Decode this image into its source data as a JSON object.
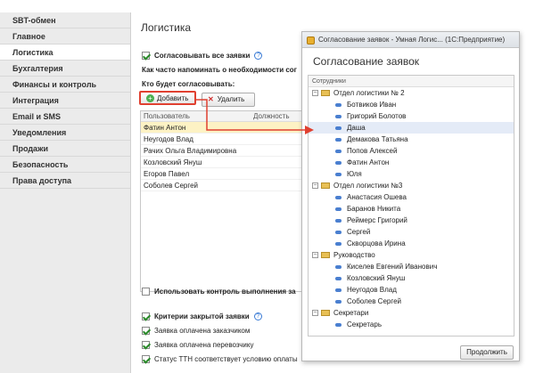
{
  "sidebar": {
    "items": [
      {
        "label": "SBT-обмен"
      },
      {
        "label": "Главное"
      },
      {
        "label": "Логистика"
      },
      {
        "label": "Бухгалтерия"
      },
      {
        "label": "Финансы и контроль"
      },
      {
        "label": "Интеграция"
      },
      {
        "label": "Email и SMS"
      },
      {
        "label": "Уведомления"
      },
      {
        "label": "Продажи"
      },
      {
        "label": "Безопасность"
      },
      {
        "label": "Права доступа"
      }
    ]
  },
  "main": {
    "title": "Логистика",
    "approve_all": "Согласовывать все заявки",
    "remind_text": "Как часто напоминать о необходимости сог",
    "who_text": "Кто будет согласовывать:",
    "add_label": "Добавить",
    "delete_label": "Удалить",
    "grid": {
      "col_user": "Пользователь",
      "col_position": "Должность",
      "rows": [
        "Фатин Антон",
        "Неугодов Влад",
        "Рачих Ольга Владимировна",
        "Козловский Януш",
        "Егоров Павел",
        "Соболев Сергей"
      ]
    },
    "control_text": "Использовать контроль выполнения за",
    "criteria_text": "Критерии закрытой заявки",
    "crit1": "Заявка оплачена заказчиком",
    "crit2": "Заявка оплачена перевозчику",
    "crit3": "Статус ТТН соответствует условию оплаты"
  },
  "dialog": {
    "window_title": "Согласование заявок - Умная Логис... (1С:Предприятие)",
    "heading": "Согласование заявок",
    "tree_header": "Сотрудники",
    "groups": [
      {
        "name": "Отдел логистики № 2",
        "members": [
          "Ботвиков Иван",
          "Григорий Болотов",
          "Даша",
          "Демакова Татьяна",
          "Попов Алексей",
          "Фатин Антон",
          "Юля"
        ]
      },
      {
        "name": "Отдел логистики №3",
        "members": [
          "Анастасия Ошева",
          "Баранов Никита",
          "Реймерс Григорий",
          "Сергей",
          "Скворцова Ирина"
        ]
      },
      {
        "name": "Руководство",
        "members": [
          "Киселев Евгений Иванович",
          "Козловский Януш",
          "Неугодов Влад",
          "Соболев Сергей"
        ]
      },
      {
        "name": "Секретари",
        "members": [
          "Секретарь"
        ]
      }
    ],
    "continue_label": "Продолжить"
  },
  "colors": {
    "highlight": "#e04030",
    "selected_row": "#fdf2c4",
    "accent": "#4a7fd0"
  }
}
